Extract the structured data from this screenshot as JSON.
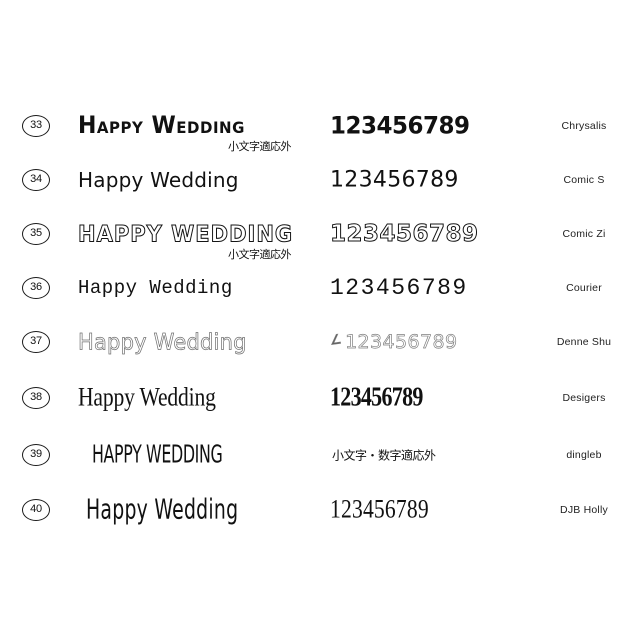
{
  "page": {
    "background_color": "#ffffff",
    "text_color": "#111111",
    "sample_word": "Happy Wedding",
    "sample_numerals": "123456789"
  },
  "rows": [
    {
      "index": "33",
      "sample": "Happy Wedding",
      "numerals": "123456789",
      "font_name": "Chrysalis",
      "note": "小文字適応外",
      "note_position": "under-sample"
    },
    {
      "index": "34",
      "sample": "Happy Wedding",
      "numerals": "123456789",
      "font_name": "Comic S",
      "note": "",
      "note_position": "none"
    },
    {
      "index": "35",
      "sample": "Happy Wedding",
      "numerals": "123456789",
      "font_name": "Comic Zi",
      "note": "小文字適応外",
      "note_position": "under-sample"
    },
    {
      "index": "36",
      "sample": "Happy Wedding",
      "numerals": "123456789",
      "font_name": "Courier",
      "note": "",
      "note_position": "none"
    },
    {
      "index": "37",
      "sample": "Happy Wedding",
      "numerals": "123456789",
      "font_name": "Denne Shu",
      "note": "",
      "note_position": "none",
      "lead_glyph": "∠"
    },
    {
      "index": "38",
      "sample": "Happy Wedding",
      "numerals": "123456789",
      "font_name": "Desigers",
      "note": "",
      "note_position": "none"
    },
    {
      "index": "39",
      "sample": "Happy Wedding",
      "numerals": "",
      "font_name": "dingleb",
      "note": "小文字・数字適応外",
      "note_position": "numerals-column"
    },
    {
      "index": "40",
      "sample": "Happy Wedding",
      "numerals": "123456789",
      "font_name": "DJB Holly",
      "note": "",
      "note_position": "none"
    }
  ]
}
